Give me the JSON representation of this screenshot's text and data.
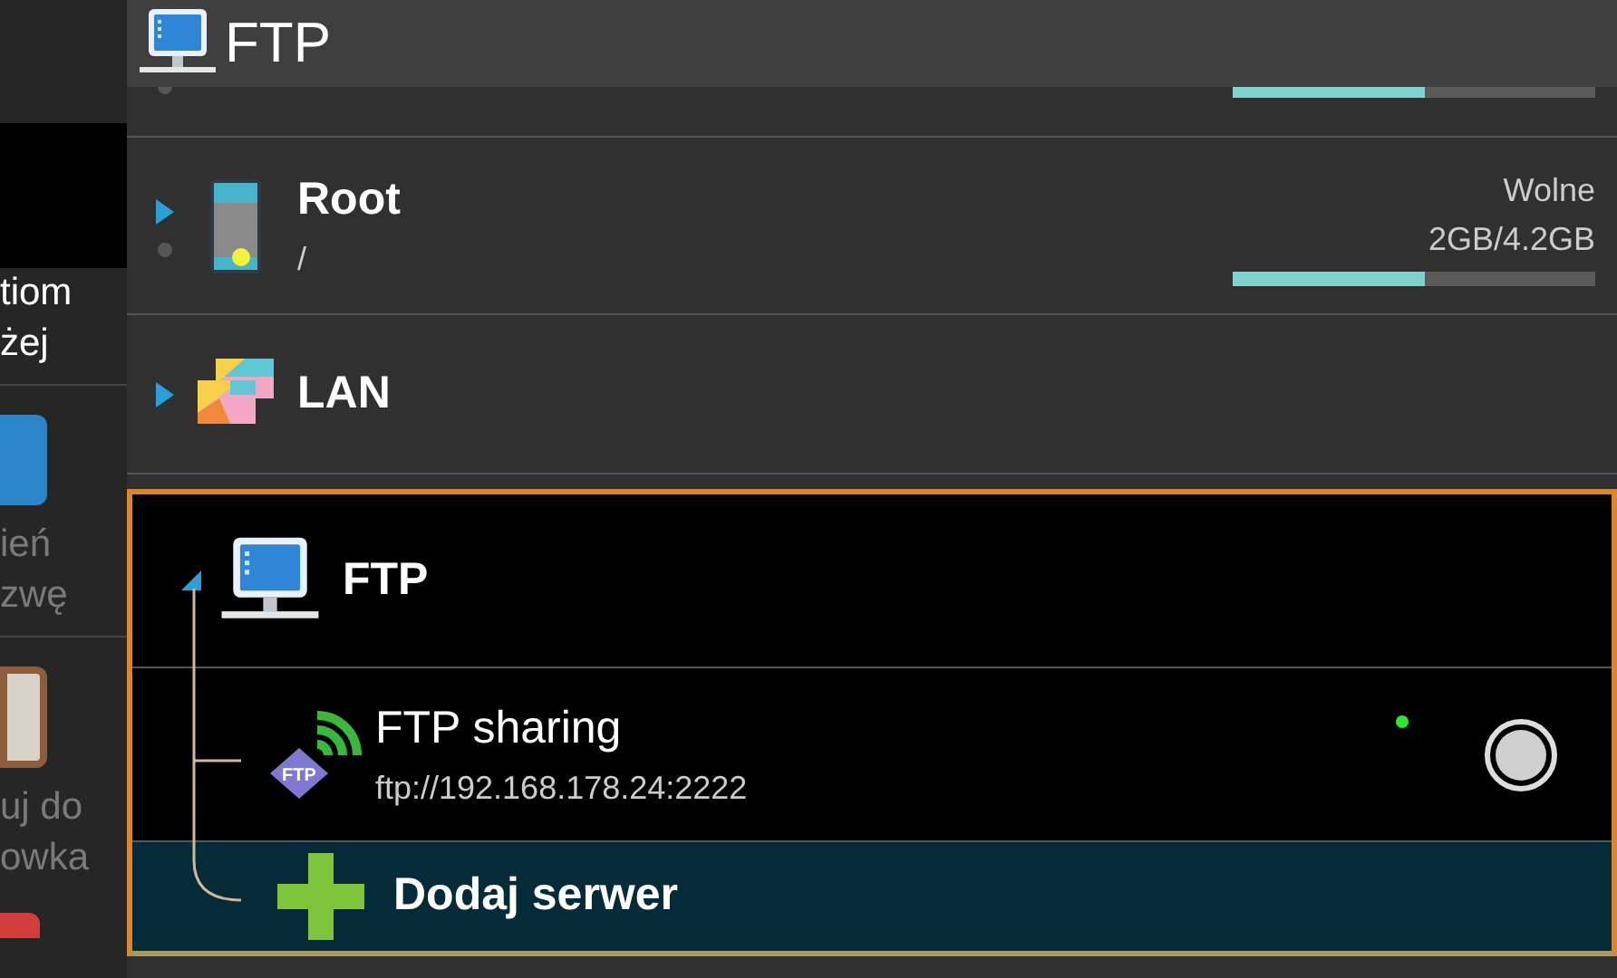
{
  "header": {
    "title": "FTP"
  },
  "side_menu": {
    "items": [
      {
        "kind": "text",
        "lines": [
          "tiom",
          "żej"
        ]
      },
      {
        "kind": "edit",
        "lines": [
          "ień",
          "zwę"
        ]
      },
      {
        "kind": "clipboard",
        "lines": [
          "uj do",
          "owka"
        ]
      },
      {
        "kind": "folder"
      }
    ]
  },
  "locations": [
    {
      "kind": "storage",
      "level": 0.53
    },
    {
      "kind": "root",
      "name": "Root",
      "path": "/",
      "free_label": "Wolne",
      "space": "2GB/4.2GB",
      "level": 0.53
    },
    {
      "kind": "lan",
      "name": "LAN"
    }
  ],
  "ftp_group": {
    "title": "FTP",
    "expanded": true,
    "servers": [
      {
        "name": "FTP sharing",
        "badge": "FTP",
        "address": "ftp://192.168.178.24:2222",
        "online": true,
        "selected": false
      }
    ],
    "add_label": "Dodaj serwer"
  }
}
